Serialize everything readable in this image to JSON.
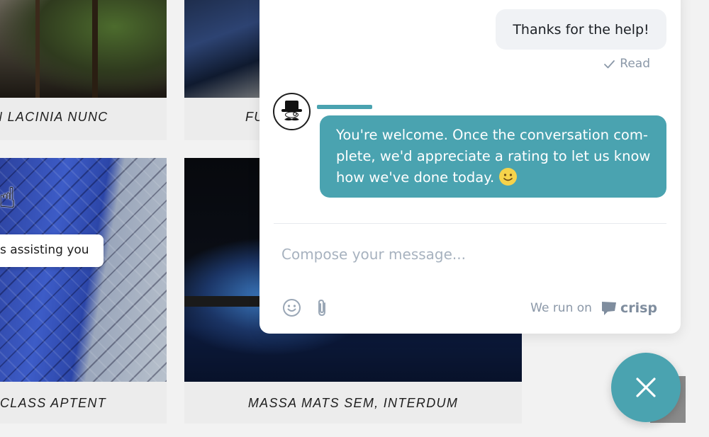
{
  "gallery": {
    "captions": [
      "N LACINIA NUNC",
      "FU",
      "CLASS APTENT",
      "MASSA MATS SEM, INTERDUM"
    ],
    "tooltip": "s assisting you"
  },
  "chat": {
    "accent_color": "#4aa3b0",
    "user_message": "Thanks for the help!",
    "read_status": "Read",
    "operator_message": "You're welcome. Once the conversation com-plete, we'd appreciate a rating to let us know how we've done today.",
    "compose_placeholder": "Compose your message...",
    "branding_prefix": "We run on",
    "branding_name": "crisp",
    "icons": {
      "read": "check-icon",
      "emoji": "smiley-icon",
      "attach": "paperclip-icon",
      "brand": "crisp-logo-icon",
      "close": "close-icon",
      "avatar": "top-hat-mustache-avatar"
    }
  }
}
